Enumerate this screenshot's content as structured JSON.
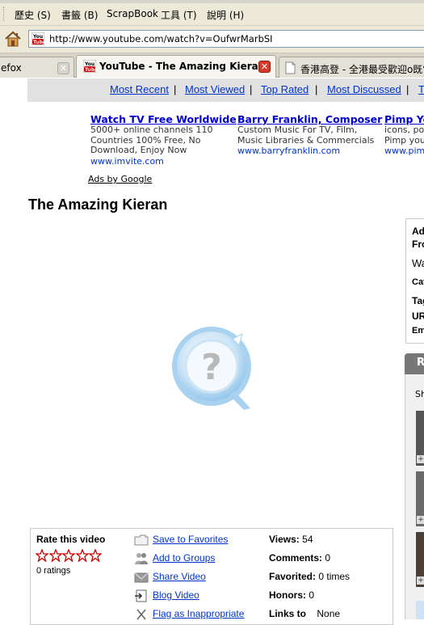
{
  "browser": {
    "menu": [
      "歷史 (S)",
      "書籤 (B)",
      "ScrapBook",
      "工具 (T)",
      "說明 (H)"
    ],
    "url": "http://www.youtube.com/watch?v=OufwrMarbSI",
    "tabs": [
      {
        "label": "efox",
        "active": false
      },
      {
        "label": "YouTube - The Amazing Kieran",
        "active": true
      },
      {
        "label": "香港高登 - 全港最受歡迎o既電",
        "active": false
      }
    ]
  },
  "site_nav": {
    "links": [
      "Most Recent",
      "Most Viewed",
      "Top Rated",
      "Most Discussed",
      "T"
    ],
    "separator": "|"
  },
  "ads": [
    {
      "title": "Watch TV Free Worldwide",
      "lines": [
        "5000+ online channels 110",
        "Countries 100% Free, No",
        "Download, Enjoy Now"
      ],
      "url": "www.imvite.com"
    },
    {
      "title": "Barry Franklin, Composer",
      "lines": [
        "Custom Music For TV, Film,",
        "Music Libraries & Commercials"
      ],
      "url": "www.barryfranklin.com"
    },
    {
      "title": "Pimp Yo",
      "lines": [
        "icons, po",
        "Pimp you"
      ],
      "url": "www.pimp"
    }
  ],
  "ads_by": "Ads by Google",
  "video": {
    "title": "The Amazing Kieran",
    "player_icon": "quicktime-missing-plugin-icon"
  },
  "sidebar": {
    "labels": [
      "Ad",
      "Fro",
      "Wa",
      "Cat",
      "Tag",
      "UR",
      "Em"
    ],
    "related_header": "R",
    "related_sub": "Sh"
  },
  "actions": {
    "rate_label": "Rate this video",
    "ratings": "0 ratings",
    "items": [
      "Save to Favorites",
      "Add to Groups",
      "Share Video",
      "Blog Video",
      "Flag as Inappropriate"
    ],
    "stats": {
      "views_label": "Views:",
      "views": "54",
      "comments_label": "Comments:",
      "comments": "0",
      "favorited_label": "Favorited:",
      "favorited": "0 times",
      "honors_label": "Honors:",
      "honors": "0",
      "links_label": "Links to",
      "links": "None"
    }
  },
  "colors": {
    "link": "#0033cc",
    "ad_title": "#0000cc",
    "star": "#cc0000",
    "nav_strip": "#e1e1e1"
  }
}
